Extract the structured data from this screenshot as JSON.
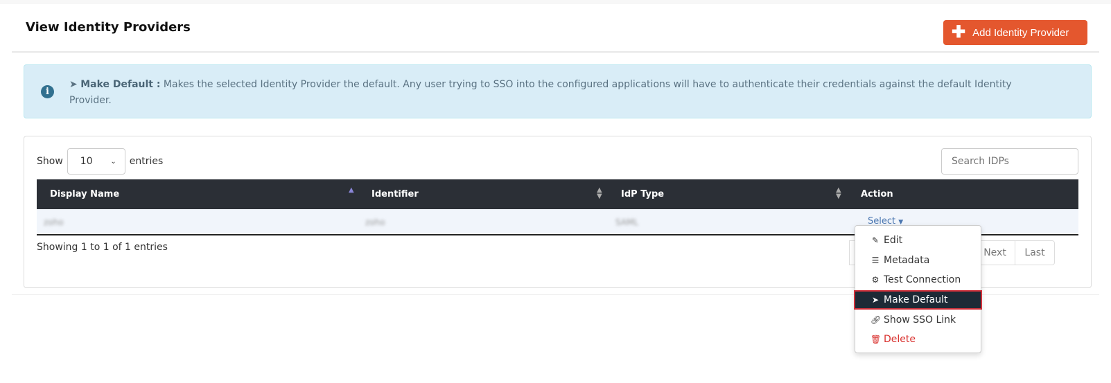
{
  "header": {
    "title": "View Identity Providers",
    "add_button": "Add Identity Provider"
  },
  "info": {
    "label": "Make Default :",
    "text": " Makes the selected Identity Provider the default. Any user trying to SSO into the configured applications will have to authenticate their credentials against the default Identity Provider."
  },
  "table_controls": {
    "show": "Show",
    "entries_value": "10",
    "entries": "entries",
    "search_placeholder": "Search IDPs"
  },
  "table": {
    "columns": [
      "Display Name",
      "Identifier",
      "IdP Type",
      "Action"
    ],
    "rows": [
      {
        "display_name": "zoho",
        "identifier": "zoho",
        "idp_type": "SAML",
        "action": "Select"
      }
    ]
  },
  "footer": {
    "showing": "Showing 1 to 1 of 1 entries",
    "pager": [
      "Next",
      "Last"
    ]
  },
  "dropdown": {
    "items": [
      "Edit",
      "Metadata",
      "Test Connection",
      "Make Default",
      "Show SSO Link",
      "Delete"
    ],
    "active": "Make Default"
  },
  "colors": {
    "accent": "#e4572e",
    "header": "#2b2f36",
    "danger": "#d9302d",
    "highlight_border": "#d0303a"
  }
}
